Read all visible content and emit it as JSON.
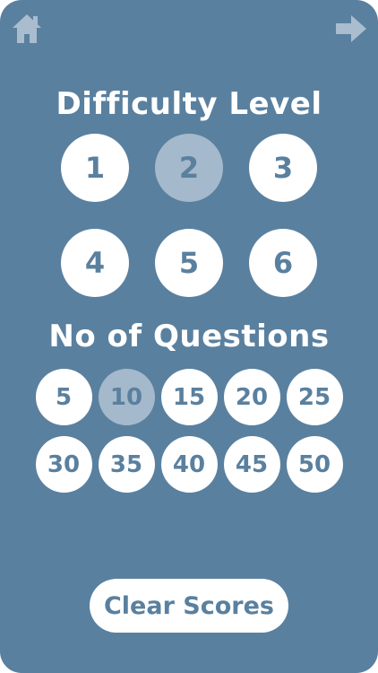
{
  "nav": {
    "home_icon": "home-icon",
    "next_icon": "arrow-right-icon"
  },
  "difficulty": {
    "title": "Difficulty Level",
    "levels": [
      "1",
      "2",
      "3",
      "4",
      "5",
      "6"
    ],
    "selected": "2"
  },
  "questions": {
    "title": "No of Questions",
    "options": [
      "5",
      "10",
      "15",
      "20",
      "25",
      "30",
      "35",
      "40",
      "45",
      "50"
    ],
    "selected": "10"
  },
  "clear_button": {
    "label": "Clear Scores"
  },
  "colors": {
    "background": "#5a809f",
    "button": "#ffffff",
    "button_text": "#5a809f",
    "selected": "#a4b9cb"
  }
}
